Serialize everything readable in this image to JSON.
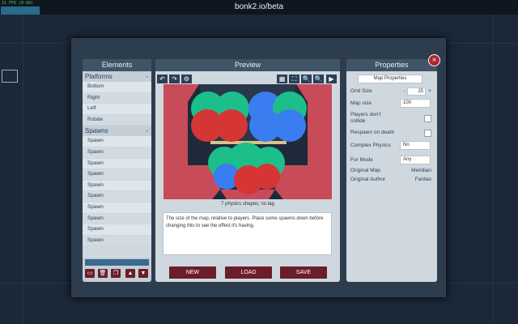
{
  "window": {
    "title": "bonk2.io/beta",
    "fps": "21 FPS (0-60)"
  },
  "modal": {
    "close_glyph": "×"
  },
  "elements": {
    "heading": "Elements",
    "sections": [
      {
        "name": "Platforms",
        "toggle": "-",
        "items": [
          "Bottom",
          "Right",
          "Left",
          "Rotate"
        ]
      },
      {
        "name": "Spawns",
        "toggle": "-",
        "items": [
          "Spawn",
          "Spawn",
          "Spawn",
          "Spawn",
          "Spawn",
          "Spawn",
          "Spawn",
          "Spawn",
          "Spawn",
          "Spawn"
        ]
      }
    ],
    "buttons": [
      {
        "name": "add-shape-icon",
        "glyph": "▭"
      },
      {
        "name": "delete-icon",
        "glyph": "🗑"
      },
      {
        "name": "duplicate-icon",
        "glyph": "❐"
      },
      {
        "name": "move-up-icon",
        "glyph": "▲"
      },
      {
        "name": "move-down-icon",
        "glyph": "▼"
      }
    ]
  },
  "preview": {
    "heading": "Preview",
    "tools_left": [
      {
        "name": "undo-icon",
        "glyph": "↶"
      },
      {
        "name": "redo-icon",
        "glyph": "↷"
      },
      {
        "name": "gear-icon",
        "glyph": "⚙"
      }
    ],
    "tools_right": [
      {
        "name": "grid-icon",
        "glyph": "▦"
      },
      {
        "name": "fit-icon",
        "glyph": "⛶"
      },
      {
        "name": "zoom-in-icon",
        "glyph": "🔍"
      },
      {
        "name": "zoom-out-icon",
        "glyph": "🔍"
      },
      {
        "name": "play-icon",
        "glyph": "▶"
      }
    ],
    "shapes_label": "7 physics shapes; no lag",
    "description": "The size of the map, relative to players. Place some spawns down before changing this to see the effect it's having.",
    "new_label": "NEW",
    "load_label": "LOAD",
    "save_label": "SAVE",
    "colors": {
      "red": "#d63535",
      "green": "#1cbf8a",
      "blue": "#3a7df0",
      "wall": "#c84b5a",
      "bg": "#1e2a3a"
    }
  },
  "properties": {
    "heading": "Properties",
    "tab": "Map Properties",
    "grid_size_label": "Grid Size",
    "grid_size_value": "25",
    "grid_minus": "-",
    "grid_plus": "+",
    "map_size_label": "Map size",
    "map_size_value": "100",
    "no_collide_label": "Players don't collide",
    "respawn_label": "Respawn on death",
    "complex_label": "Complex Physics",
    "complex_value": "No",
    "for_mode_label": "For Mode",
    "for_mode_value": "Any",
    "original_map_label": "Original Map",
    "original_map_value": "Meridian",
    "original_author_label": "Original Author",
    "original_author_value": "Fantao"
  }
}
